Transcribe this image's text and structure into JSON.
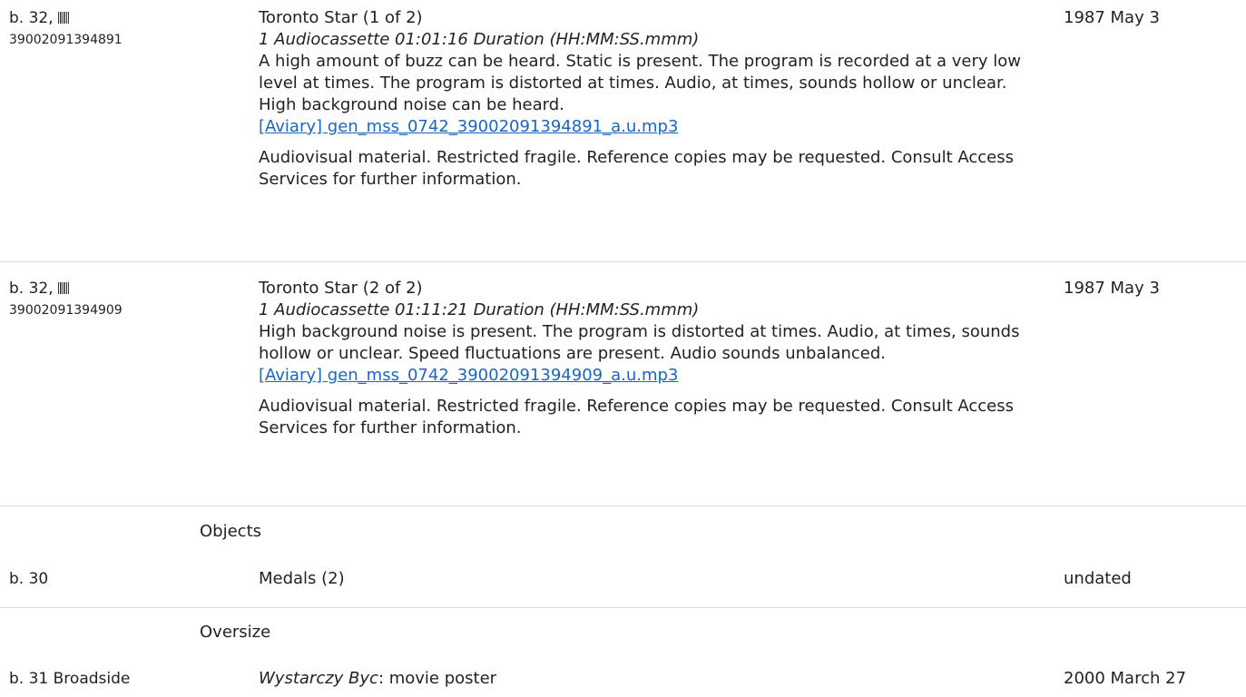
{
  "rows": [
    {
      "box": "b. 32,",
      "barcode": "39002091394891",
      "title": "Toronto Star (1 of 2)",
      "extent": "1 Audiocassette  01:01:16 Duration (HH:MM:SS.mmm)",
      "condition": "A high amount of buzz can be heard. Static is present. The program is recorded at a very low level at times. The program is distorted at times. Audio, at times, sounds hollow or unclear. High background noise can be heard.",
      "link": "[Aviary] gen_mss_0742_39002091394891_a.u.mp3",
      "note": "Audiovisual material. Restricted fragile. Reference copies may be requested. Consult Access Services for further information.",
      "date": "1987 May 3"
    },
    {
      "box": "b. 32,",
      "barcode": "39002091394909",
      "title": "Toronto Star (2 of 2)",
      "extent": "1 Audiocassette  01:11:21 Duration (HH:MM:SS.mmm)",
      "condition": "High background noise is present. The program is distorted at times. Audio, at times, sounds hollow or unclear. Speed fluctuations are present. Audio sounds unbalanced.",
      "link": "[Aviary] gen_mss_0742_39002091394909_a.u.mp3",
      "note": "Audiovisual material. Restricted fragile. Reference copies may be requested. Consult Access Services for further information.",
      "date": "1987 May 3"
    }
  ],
  "objects": {
    "heading": "Objects",
    "box": "b. 30",
    "title": "Medals (2)",
    "date": "undated"
  },
  "oversize": {
    "heading": "Oversize",
    "box": "b. 31 Broadside",
    "title_italic": "Wystarczy Byc",
    "title_rest": ": movie poster",
    "date": "2000 March 27"
  }
}
